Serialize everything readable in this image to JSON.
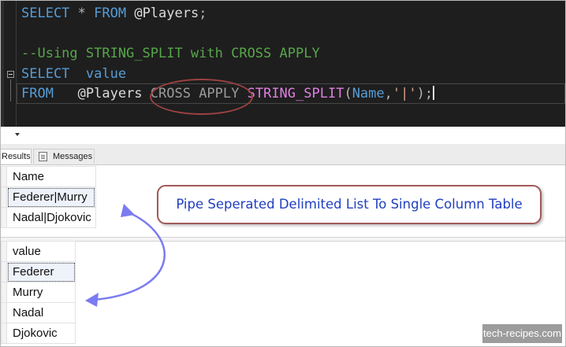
{
  "editor": {
    "line1": {
      "select": "SELECT",
      "star": " * ",
      "from": "FROM",
      "table": " @Players",
      "semi": ";"
    },
    "line3": {
      "comment": "--Using STRING_SPLIT with CROSS APPLY"
    },
    "line4": {
      "select": "SELECT",
      "col": "  value"
    },
    "line5": {
      "from": "FROM",
      "table": "   @Players ",
      "cross_apply": "CROSS APPLY",
      "fn": " STRING_SPLIT",
      "open": "(",
      "arg": "Name",
      "comma": ",",
      "str_a": "'",
      "pipe": "|",
      "str_b": "'",
      "close": ");"
    }
  },
  "tabs": {
    "results": "Results",
    "messages": "Messages"
  },
  "grid1": {
    "header": "Name",
    "rows": [
      "Federer|Murry",
      "Nadal|Djokovic"
    ]
  },
  "grid2": {
    "header": "value",
    "rows": [
      "Federer",
      "Murry",
      "Nadal",
      "Djokovic"
    ]
  },
  "callout": {
    "text": "Pipe Seperated Delimited List To Single Column Table"
  },
  "watermark": {
    "text": "tech-recipes.com"
  },
  "colors": {
    "keyword": "#569cd6",
    "comment": "#57a64a",
    "function": "#e07fe3",
    "string": "#d69d85",
    "callout_text": "#1f3fbf",
    "arrow": "#7b7bf2",
    "ring": "#9c4141"
  }
}
